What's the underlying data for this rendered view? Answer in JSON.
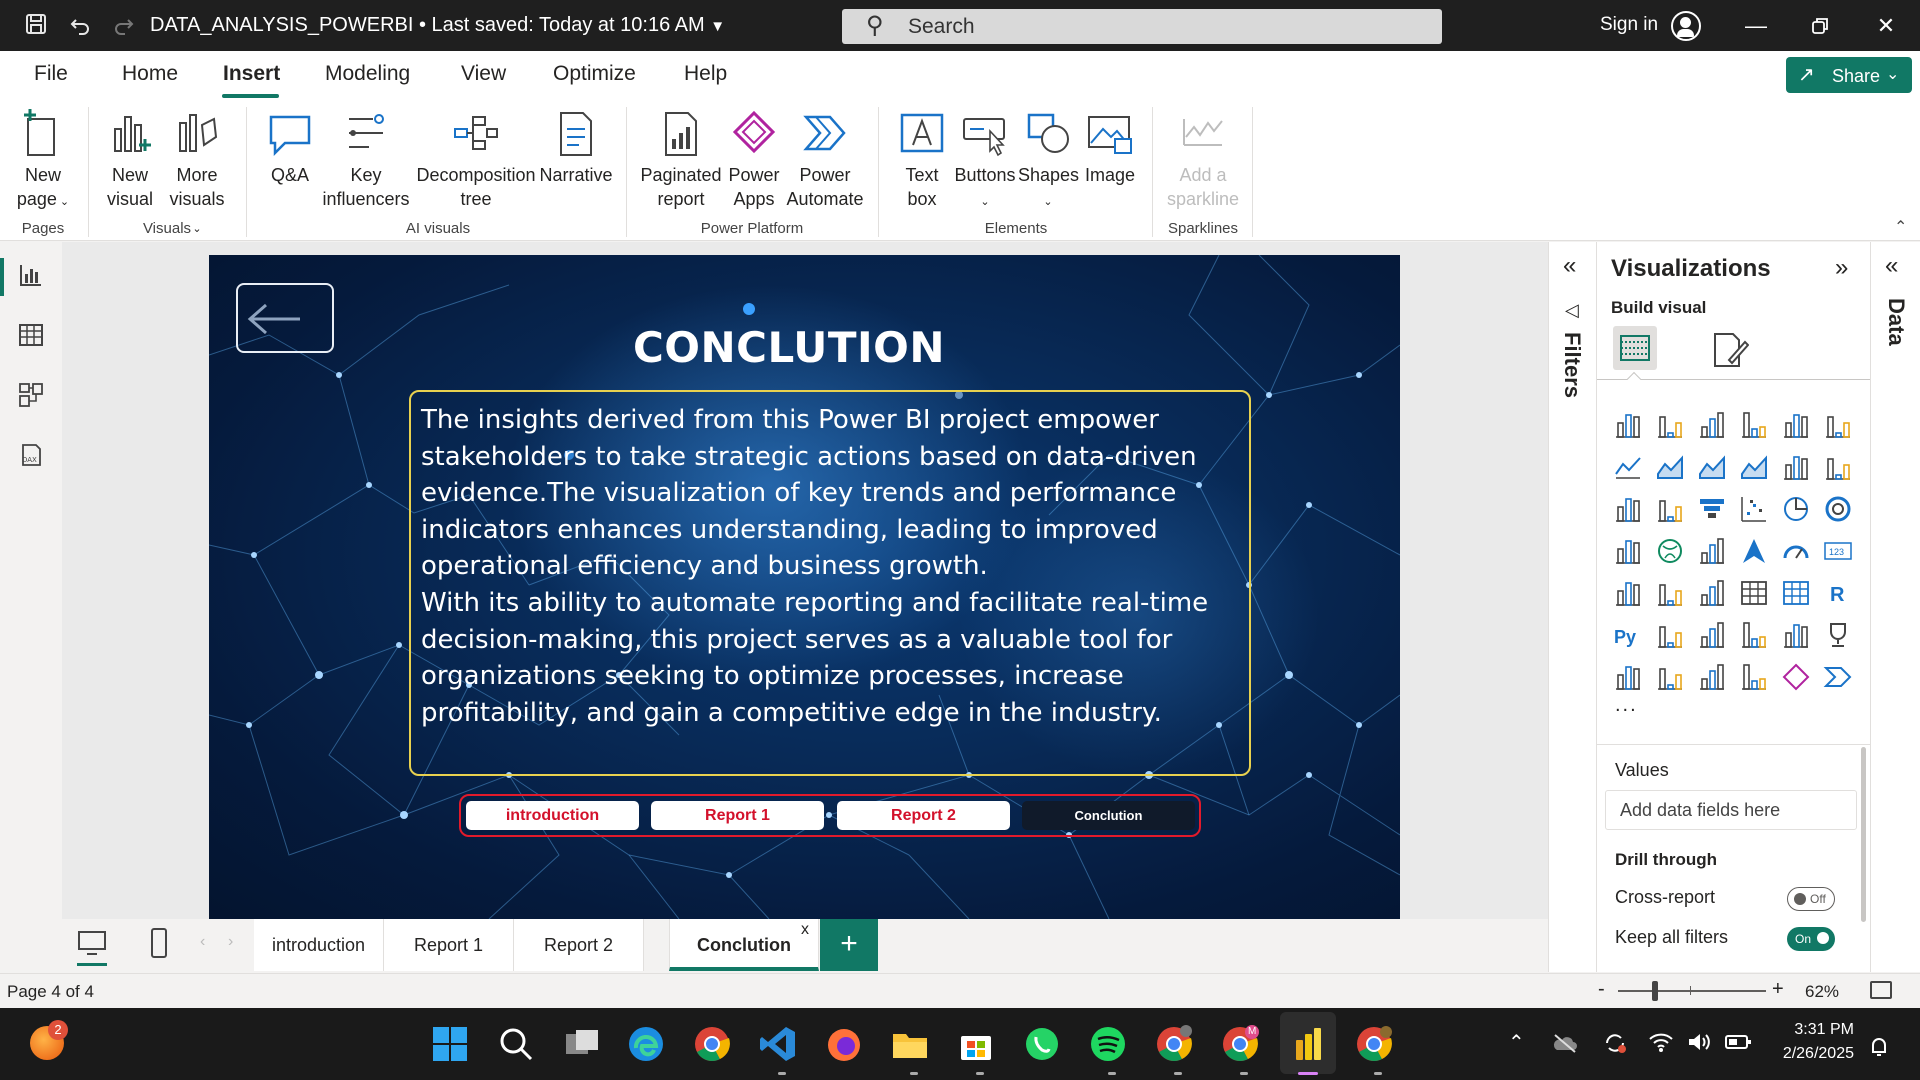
{
  "titlebar": {
    "document_title": "DATA_ANALYSIS_POWERBI • Last saved: Today at 10:16 AM",
    "search_placeholder": "Search",
    "sign_in": "Sign in"
  },
  "menu": {
    "tabs": [
      "File",
      "Home",
      "Insert",
      "Modeling",
      "View",
      "Optimize",
      "Help"
    ],
    "active_tab": "Insert",
    "share_label": "Share"
  },
  "ribbon": {
    "buttons": {
      "new_page": [
        "New",
        "page"
      ],
      "new_visual": [
        "New",
        "visual"
      ],
      "more_visuals": [
        "More",
        "visuals"
      ],
      "qa": [
        "Q&A"
      ],
      "key_influencers": [
        "Key",
        "influencers"
      ],
      "decomposition_tree": [
        "Decomposition",
        "tree"
      ],
      "narrative": [
        "Narrative"
      ],
      "paginated_report": [
        "Paginated",
        "report"
      ],
      "power_apps": [
        "Power",
        "Apps"
      ],
      "power_automate": [
        "Power",
        "Automate"
      ],
      "text_box": [
        "Text",
        "box"
      ],
      "buttons": [
        "Buttons"
      ],
      "shapes": [
        "Shapes"
      ],
      "image": [
        "Image"
      ],
      "add_sparkline": [
        "Add a",
        "sparkline"
      ]
    },
    "groups": {
      "pages": "Pages",
      "visuals": "Visuals",
      "ai_visuals": "AI visuals",
      "power_platform": "Power Platform",
      "elements": "Elements",
      "sparklines": "Sparklines"
    }
  },
  "report": {
    "heading": "CONCLUTION",
    "paragraph_1": "The insights derived from this Power BI project empower stakeholders to take strategic actions based on data-driven evidence.The visualization of key trends and performance indicators enhances understanding, leading to improved operational efficiency and business growth.",
    "paragraph_2": "With its ability to automate reporting and facilitate real-time decision-making, this project serves as a valuable tool for organizations seeking to optimize processes, increase profitability, and gain a competitive edge in the industry.",
    "nav_buttons": [
      "introduction",
      "Report 1",
      "Report 2",
      "Conclution"
    ],
    "current_nav": "Conclution"
  },
  "page_tabs": {
    "tabs": [
      "introduction",
      "Report 1",
      "Report 2",
      "Conclution"
    ],
    "active": "Conclution",
    "close_glyph": "x"
  },
  "statusbar": {
    "page_count": "Page 4 of 4",
    "zoom_level": "62%",
    "zoom_fraction": 0.25
  },
  "panes": {
    "filters_label": "Filters",
    "data_label": "Data",
    "visualizations_title": "Visualizations",
    "build_visual": "Build visual",
    "more_glyph": "...",
    "values_label": "Values",
    "values_placeholder": "Add data fields here",
    "drill_through": "Drill through",
    "cross_report": "Cross-report",
    "cross_report_state": "Off",
    "keep_all_filters": "Keep all filters",
    "keep_all_filters_state": "On",
    "r_label": "R",
    "py_label": "Py",
    "num_label": "123"
  },
  "taskbar": {
    "time": "3:31 PM",
    "date": "2/26/2025",
    "notification_badge": "2",
    "chrome_profile_letter": "M"
  },
  "colors": {
    "accent": "#117865",
    "title_bar": "#1f1f1f",
    "report_border": "#e8d14f",
    "nav_border": "#e21a2b",
    "nav_text": "#d3112b"
  }
}
